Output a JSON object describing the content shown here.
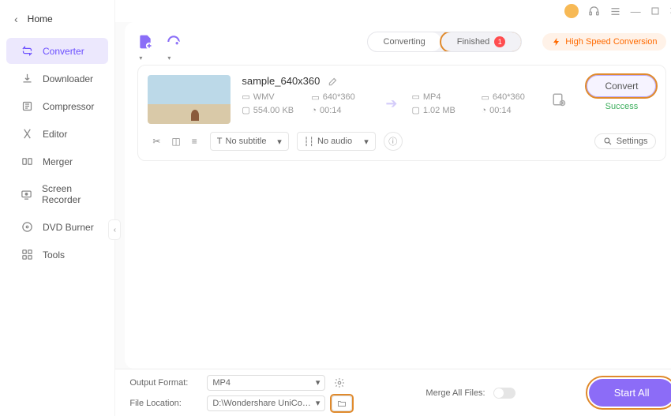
{
  "home": "Home",
  "sidebar": {
    "items": [
      {
        "label": "Converter"
      },
      {
        "label": "Downloader"
      },
      {
        "label": "Compressor"
      },
      {
        "label": "Editor"
      },
      {
        "label": "Merger"
      },
      {
        "label": "Screen Recorder"
      },
      {
        "label": "DVD Burner"
      },
      {
        "label": "Tools"
      }
    ]
  },
  "tabs": {
    "converting": "Converting",
    "finished": "Finished",
    "finished_count": "1"
  },
  "hs_conversion": "High Speed Conversion",
  "item": {
    "title": "sample_640x360",
    "src": {
      "format": "WMV",
      "resolution": "640*360",
      "size": "554.00 KB",
      "duration": "00:14"
    },
    "dst": {
      "format": "MP4",
      "resolution": "640*360",
      "size": "1.02 MB",
      "duration": "00:14"
    },
    "subtitle": "No subtitle",
    "audio": "No audio",
    "settings": "Settings",
    "convert": "Convert",
    "status": "Success"
  },
  "footer": {
    "output_format_label": "Output Format:",
    "output_format_value": "MP4",
    "file_location_label": "File Location:",
    "file_location_value": "D:\\Wondershare UniConverter 1",
    "merge_label": "Merge All Files:",
    "start_all": "Start All"
  }
}
